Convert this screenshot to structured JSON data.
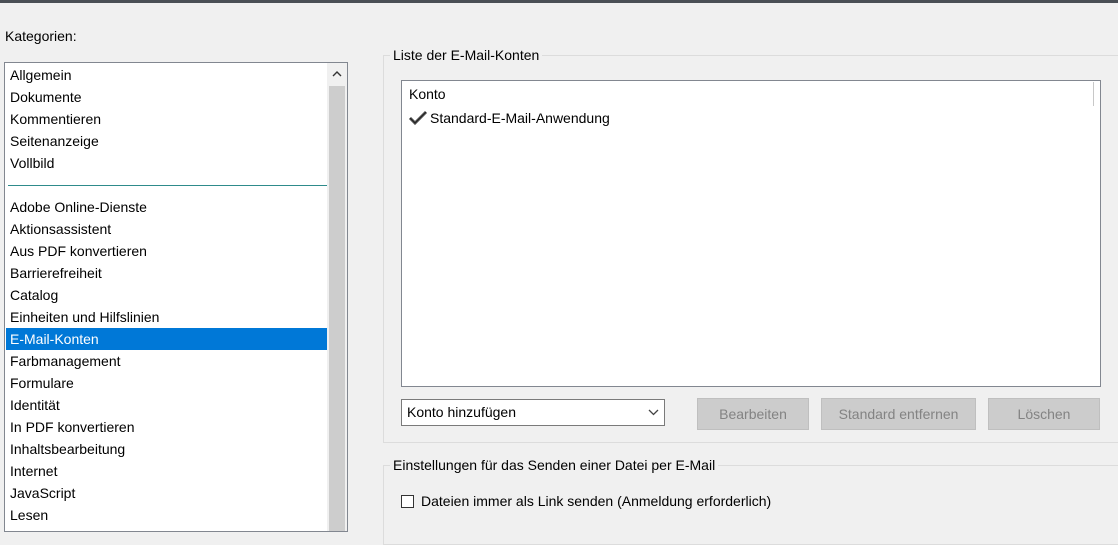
{
  "categories": {
    "label": "Kategorien:",
    "top_items": [
      "Allgemein",
      "Dokumente",
      "Kommentieren",
      "Seitenanzeige",
      "Vollbild"
    ],
    "items": [
      "Adobe Online-Dienste",
      "Aktionsassistent",
      "Aus PDF konvertieren",
      "Barrierefreiheit",
      "Catalog",
      "Einheiten und Hilfslinien",
      "E-Mail-Konten",
      "Farbmanagement",
      "Formulare",
      "Identität",
      "In PDF konvertieren",
      "Inhaltsbearbeitung",
      "Internet",
      "JavaScript",
      "Lesen"
    ],
    "selected": "E-Mail-Konten"
  },
  "email_accounts": {
    "group_title": "Liste der E-Mail-Konten",
    "column_header": "Konto",
    "rows": [
      {
        "name": "Standard-E-Mail-Anwendung",
        "icon": "checkmark-icon"
      }
    ],
    "add_combo_value": "Konto hinzufügen",
    "edit_label": "Bearbeiten",
    "remove_default_label": "Standard entfernen",
    "delete_label": "Löschen"
  },
  "send_settings": {
    "group_title": "Einstellungen für das Senden einer Datei per E-Mail",
    "always_link_label": "Dateien immer als Link senden (Anmeldung erforderlich)",
    "always_link_checked": false
  },
  "colors": {
    "selection": "#0078d7",
    "separator": "#2e8b8b",
    "disabled_text": "#838383"
  }
}
